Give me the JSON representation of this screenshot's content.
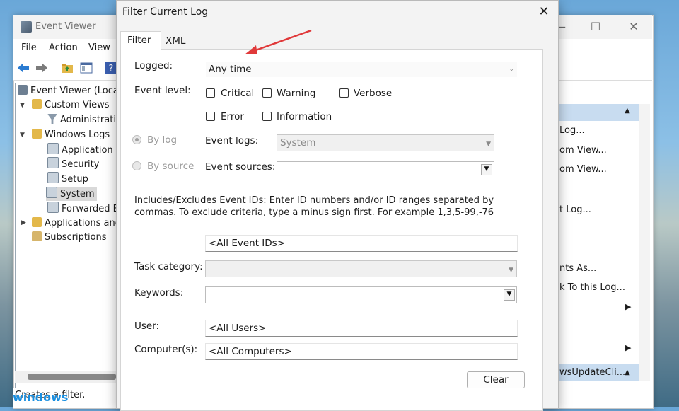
{
  "event_viewer": {
    "title": "Event Viewer",
    "window_controls": {
      "minimize": "—",
      "maximize": "☐",
      "close": "✕"
    },
    "menu": [
      "File",
      "Action",
      "View"
    ],
    "tree": [
      {
        "label": "Event Viewer (Local)"
      },
      {
        "label": "Custom Views"
      },
      {
        "label": "Administrati"
      },
      {
        "label": "Windows Logs"
      },
      {
        "label": "Application"
      },
      {
        "label": "Security"
      },
      {
        "label": "Setup"
      },
      {
        "label": "System"
      },
      {
        "label": "Forwarded E"
      },
      {
        "label": "Applications and"
      },
      {
        "label": "Subscriptions"
      }
    ],
    "actions": [
      "Log...",
      "om View...",
      "om View...",
      "t Log...",
      "nts As...",
      "k To this Log...",
      "wsUpdateCli..."
    ],
    "status_text": "Creates a filter.",
    "wallpaper_logo": "windows"
  },
  "dialog": {
    "title": "Filter Current Log",
    "close_glyph": "✕",
    "tabs": [
      "Filter",
      "XML"
    ],
    "logged": {
      "label": "Logged:",
      "value": "Any time"
    },
    "event_level": {
      "label": "Event level:",
      "options": [
        {
          "label": "Critical",
          "checked": false
        },
        {
          "label": "Warning",
          "checked": false
        },
        {
          "label": "Verbose",
          "checked": false
        },
        {
          "label": "Error",
          "checked": false
        },
        {
          "label": "Information",
          "checked": false
        }
      ]
    },
    "by_log": {
      "label": "By log",
      "selected": true
    },
    "by_source": {
      "label": "By source",
      "selected": false
    },
    "event_logs": {
      "label": "Event logs:",
      "value": "System"
    },
    "event_sources": {
      "label": "Event sources:",
      "value": ""
    },
    "description": "Includes/Excludes Event IDs: Enter ID numbers and/or ID ranges separated by commas. To exclude criteria, type a minus sign first. For example 1,3,5-99,-76",
    "event_ids": {
      "value": "<All Event IDs>"
    },
    "task_category": {
      "label": "Task category:",
      "value": ""
    },
    "keywords": {
      "label": "Keywords:",
      "value": ""
    },
    "user": {
      "label": "User:",
      "value": "<All Users>"
    },
    "computer": {
      "label": "Computer(s):",
      "value": "<All Computers>"
    },
    "clear_button": "Clear",
    "annotation_arrow_color": "#e0393a"
  },
  "icons": {
    "back": "back-arrow-icon",
    "forward": "forward-arrow-icon",
    "dropdown": "chevron-down-icon",
    "close": "close-icon"
  }
}
